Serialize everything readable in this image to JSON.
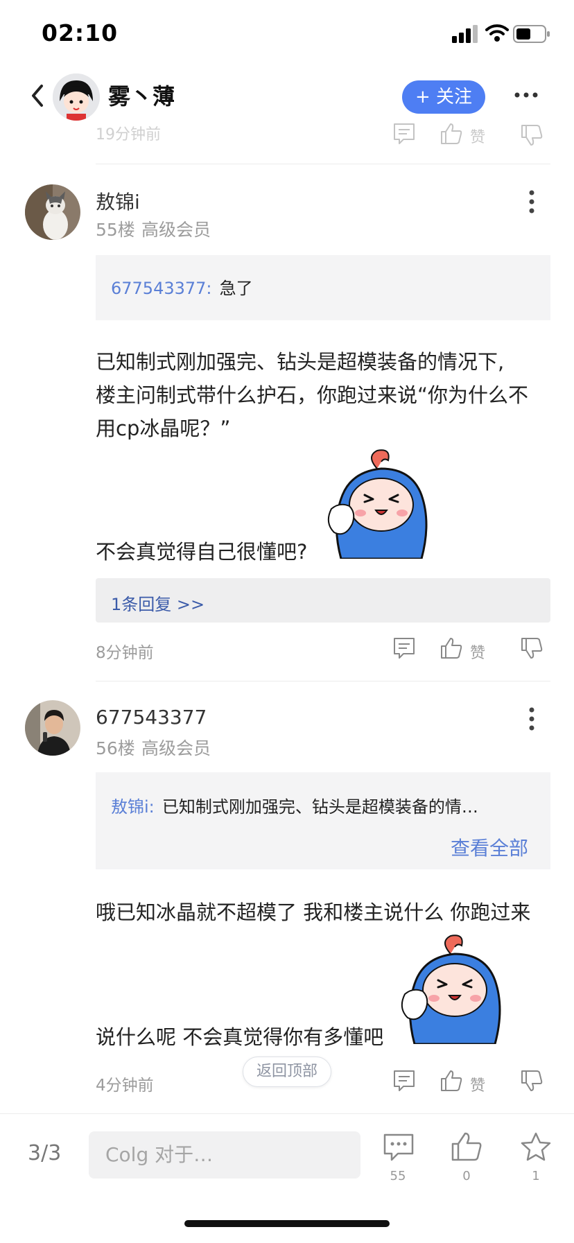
{
  "status_bar": {
    "time": "02:10"
  },
  "header": {
    "username": "雾丶薄",
    "follow_label": "+ 关注"
  },
  "previous_comment": {
    "timestamp": "19分钟前",
    "like_label": "赞"
  },
  "comments": [
    {
      "author": "敖锦i",
      "floor": "55楼",
      "level": "高级会员",
      "quote_user": "677543377:",
      "quote_text": "急了",
      "body_line1": "已知制式刚加强完、钻头是超模装备的情况下,",
      "body_line2": "楼主问制式带什么护石，你跑过来说“你为什么不",
      "body_line3": "用cp冰晶呢？”",
      "body_line4": "不会真觉得自己很懂吧?",
      "reply_link": "1条回复 >>",
      "timestamp": "8分钟前",
      "like_label": "赞"
    },
    {
      "author": "677543377",
      "floor": "56楼",
      "level": "高级会员",
      "quote_user": "敖锦i:",
      "quote_text": "已知制式刚加强完、钻头是超模装备的情…",
      "view_all": "查看全部",
      "body_line1": "哦已知冰晶就不超模了 我和楼主说什么 你跑过来",
      "body_line2": "说什么呢 不会真觉得你有多懂吧",
      "timestamp": "4分钟前",
      "like_label": "赞"
    }
  ],
  "back_to_top": "返回顶部",
  "bottom_bar": {
    "page_indicator": "3/3",
    "input_placeholder": "Colg 对于…",
    "comment_count": "55",
    "like_count": "0",
    "favorite_count": "1"
  },
  "colors": {
    "accent": "#4e7ef3",
    "quote_link": "#5a7fd6",
    "reply_link": "#3b5ba9"
  }
}
